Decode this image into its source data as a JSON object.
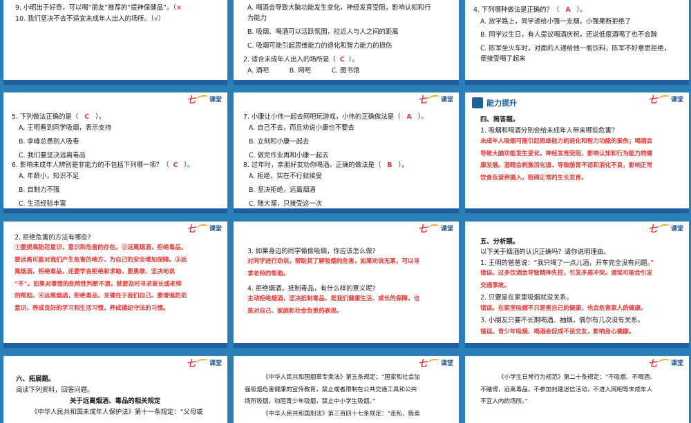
{
  "logo": {
    "seven": "七",
    "ketang": "课堂"
  },
  "s1": {
    "q9a": "9. 小昭出于好奇，可以喝“朋友”推荐的“提神保健品”。（",
    "q9ans": "×",
    "q10a": "10. 我们坚决不去不适宜未成年人出入的场所。（",
    "q10ans": "√",
    "q10b": "）"
  },
  "s2": {
    "a_l1": "A. 喝酒会导致大脑功能发生变化，神经发育受阻，影响认知和行",
    "a_l2": "为能力",
    "b": "B. 吸烟、喝酒可以活跃氛围，拉近人与人之间的距离",
    "c": "C. 吸烟可能引起思维能力的退化和智力能力的损伤",
    "q2a": "2. 适合未成年人出入的场所是（",
    "q2ans": "C",
    "q2b": "）。",
    "opts": "A. 酒吧          B. 网吧          C. 图书馆"
  },
  "s3": {
    "q4a": "4. 下列哪种做法是正确的？（",
    "q4ans": "A",
    "q4b": "）。",
    "a": "A. 放学路上，同学递给小强一支烟，小强果断拒绝了",
    "b": "B. 同学过生日，有人提议喝酒庆祝，还说低度酒喝了也不会醉",
    "c_l1": "C. 陈军坐火车时，对面的人递给他一瓶饮料，陈军不好意思拒绝，",
    "c_l2": "便接受喝了起来"
  },
  "s4": {
    "q5a": "5. 下列做法正确的是（",
    "q5ans": "C",
    "q5b": "）。",
    "a": "A. 王明看到同学吸烟，表示支持",
    "b": "B. 李峰总愚别人吸毒",
    "c": "C. 我们要坚决远离毒品",
    "q6a": "6. 影响未成年人辨别是非能力的不包括下列哪一项？（",
    "q6ans": "C",
    "q6b": "）。",
    "a6": "A. 年龄小，知识不足",
    "b6": "B. 自制力不强",
    "c6": "C. 生活经验丰富"
  },
  "s5": {
    "q7a": "7. 小康让小伟一起去网吧玩游戏，小伟的正确做法是（",
    "q7ans": "A",
    "q7b": "）。",
    "a": "A. 自己不去，而且劝说小康也不要去",
    "b": "B. 立刻和小康一起去",
    "c": "C. 做完作业再和小康一起去",
    "q8a": "8. 过年时，亲朋好友劝你喝酒。正确的做法是（",
    "q8ans": "B",
    "q8b": "）。",
    "a8": "A. 拒绝，实在不行就接受",
    "b8": "B. 坚决拒绝，远离烟酒",
    "c8": "C. 随大溜，只接受这一次"
  },
  "s6": {
    "tag": "能力提升",
    "h": "四、简答题。",
    "q1": "1. 吸烟和喝酒分别会给未成年人带来哪些危害？",
    "ans": [
      "未成年人吸烟可能引起思维能力的退化和智力功能的损伤；喝酒会",
      "导致大脑功能发生变化，神经发育受阻，影响认知和行为能力的健",
      "康发展。酒精会刺激消化道，导致肠胃不适和消化不良，影响正常",
      "饮食及营养摄入，阻碍正常的生长发育。"
    ]
  },
  "s7": {
    "q2": "2. 拒绝危害的方法有哪些?",
    "ans": [
      "①要提高防范意识，意识到危害的存在。②远离烟酒，拒绝毒品，",
      "要远离可能对我们产生危害的地方，为自己的安全增加保障。③远",
      "离烟酒，拒绝毒品，还要学会拒绝和求助，要勇敢、坚决地说",
      "“不”。如果对事情的危险性判断不清，就要及时寻求家长或老师",
      "的帮助。④远离烟酒，拒绝毒品，关键在于我们自己。要增强防范",
      "意识，养成良好的学习和生活习惯，养成遵纪守法的习惯。"
    ]
  },
  "s8": {
    "q3": "3. 如果身边的同学偷偷吸烟，你应该怎么做?",
    "a3": [
      "对同学进行劝说，帮助其了解吸烟的危害，如果劝说无果，可以寻",
      "求老师的帮助。"
    ],
    "q4": "4. 拒绝烟酒，抵制毒品，有什么样的意义呢?",
    "a4": [
      "主动拒绝烟酒，坚决抵制毒品，是我们健康生活、成长的保障，也",
      "是对自己、家庭和社会负责的表现。"
    ]
  },
  "s9": {
    "h": "五、分析题。",
    "intro": "以下关于烟酒的认识正确吗？请你说明理由。",
    "q1": "1. 王明的爸爸说：“我只喝了一点儿酒，开车完全没有问题。”",
    "a1": [
      "错误。过多饮酒会导致精神失控，引发矛盾冲突。酒驾可能会引发",
      "交通事故。"
    ],
    "q2": "2. 只要是在家里吸烟就没关系。",
    "a2": "错误。在家里吸烟不只是害自己的健康，也会危害家人的健康。",
    "q3": "3. 小朋友只要不长期喝酒、抽烟，偶尔有几次没有关系。",
    "a3": "错误。青少年吸烟、喝酒会促成不良交友，影响身心健康。"
  },
  "s10": {
    "h": "六、拓展题。",
    "intro": "阅读下列资料，回答问题。",
    "title": "关于远离烟酒、毒品的相关规定",
    "l1": "《中华人民共和国未成年人保护法》第十一条规定：“父母或"
  },
  "s11": {
    "l": [
      "《中华人民共和国烟草专卖法》第五条规定：“国家和社会加",
      "强吸烟危害健康的宣传教育，禁止或者限制在公共交通工具和公共",
      "场所吸烟，劝阻青少年吸烟，禁止中小学生吸烟。”",
      "《中华人民共和国刑法》第三百四十七条规定：“走私、贩卖"
    ]
  },
  "s12": {
    "l": [
      "《小学生日常行为规范》第二十条规定：“不吸烟、不喝酒、",
      "不赌博，远离毒品，不参加封建迷信活动，不进入网吧等未成年人",
      "不宜入内的场所。”"
    ]
  }
}
